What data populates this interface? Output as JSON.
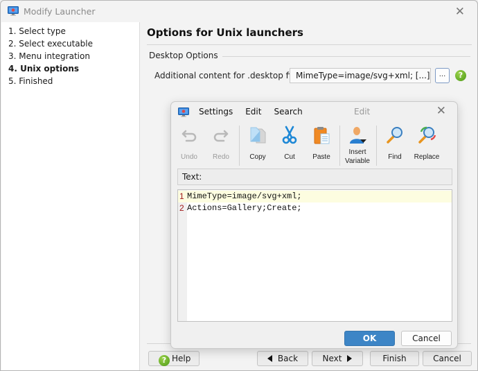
{
  "window": {
    "title": "Modify Launcher",
    "icon": "monitor-app-icon",
    "close_icon": "close-icon"
  },
  "sidebar": {
    "steps": [
      {
        "label": "1. Select type",
        "active": false
      },
      {
        "label": "2. Select executable",
        "active": false
      },
      {
        "label": "3. Menu integration",
        "active": false
      },
      {
        "label": "4. Unix options",
        "active": true
      },
      {
        "label": "5. Finished",
        "active": false
      }
    ]
  },
  "main": {
    "title": "Options for Unix launchers",
    "section": "Desktop Options",
    "field_label": "Additional content for .desktop file:",
    "field_value": "MimeType=image/svg+xml; [...]",
    "browse_label": "...",
    "help_icon": "help-icon"
  },
  "footer": {
    "help": "Help",
    "back": "Back",
    "next": "Next",
    "finish": "Finish",
    "cancel": "Cancel"
  },
  "dialog": {
    "title": "Edit",
    "menu": [
      "Settings",
      "Edit",
      "Search"
    ],
    "toolbar": [
      {
        "label": "Undo",
        "icon": "undo-icon",
        "enabled": false
      },
      {
        "label": "Redo",
        "icon": "redo-icon",
        "enabled": false
      },
      {
        "label": "Copy",
        "icon": "copy-icon",
        "enabled": true
      },
      {
        "label": "Cut",
        "icon": "cut-icon",
        "enabled": true
      },
      {
        "label": "Paste",
        "icon": "paste-icon",
        "enabled": true
      },
      {
        "label": "Insert Variable",
        "label_line1": "Insert",
        "label_line2": "Variable",
        "icon": "insert-variable-icon",
        "enabled": true
      },
      {
        "label": "Find",
        "icon": "find-icon",
        "enabled": true
      },
      {
        "label": "Replace",
        "icon": "replace-icon",
        "enabled": true
      }
    ],
    "text_label": "Text:",
    "lines": [
      {
        "number": "1",
        "code": "MimeType=image/svg+xml;"
      },
      {
        "number": "2",
        "code": "Actions=Gallery;Create;"
      }
    ],
    "ok": "OK",
    "cancel": "Cancel"
  }
}
